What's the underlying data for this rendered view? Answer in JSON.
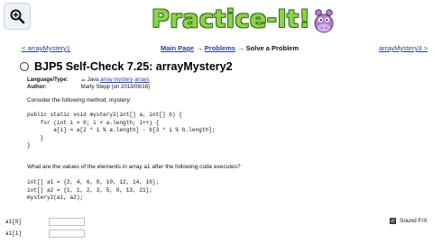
{
  "header": {
    "logo_text": "Practice-It!"
  },
  "nav": {
    "prev": "< arrayMystery1",
    "next": "arrayMystery3 >",
    "main_page": "Main Page",
    "problems": "Problems",
    "arrow": "→",
    "current": "Solve a Problem"
  },
  "problem": {
    "title": "BJP5 Self-Check 7.25: arrayMystery2",
    "language_label": "Language/Type:",
    "language_value": "☕ Java",
    "tag1": "array mystery",
    "tag2": "arrays",
    "author_label": "Author:",
    "author_value": "Marty Stepp (on 2013/09/18)",
    "intro": "Consider the following method, mystery:",
    "method_code": [
      "public static void mystery2(int[] a, int[] b) {",
      "    for (int i = 0; i < a.length; i++) {",
      "        a[i] = a[2 * i % a.length] - b[3 * i % b.length];",
      "    }",
      "}"
    ],
    "question": "What are the values of the elements in array a1 after the following code executes?",
    "call_code": [
      "int[] a1 = {2, 4, 6, 8, 10, 12, 14, 16};",
      "int[] a2 = {1, 1, 2, 3, 5, 8, 13, 21};",
      "mystery2(a1, a2);"
    ]
  },
  "answers": {
    "labels": [
      "a1[0]",
      "a1[1]"
    ]
  },
  "sound": {
    "label": "Sound F/X",
    "checked": true
  }
}
